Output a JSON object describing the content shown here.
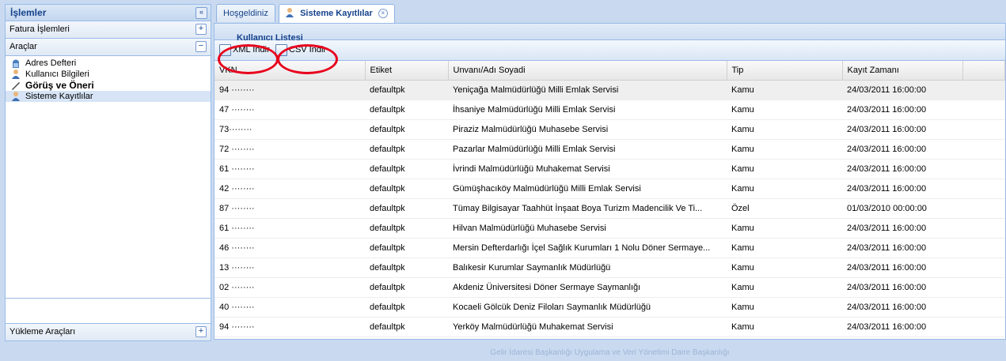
{
  "left_panel": {
    "title": "İşlemler",
    "collapse_glyph": "«",
    "sections": [
      {
        "label": "Fatura İşlemleri",
        "toggle": "+"
      },
      {
        "label": "Araçlar",
        "toggle": "−"
      }
    ],
    "tree_items": [
      {
        "label": "Adres Defteri",
        "icon": "address-book-icon"
      },
      {
        "label": "Kullanıcı Bilgileri",
        "icon": "user-icon"
      },
      {
        "label": "Görüş ve Öneri",
        "icon": "pen-icon"
      },
      {
        "label": "Sisteme Kayıtlılar",
        "icon": "user-icon"
      }
    ],
    "bottom_section": {
      "label": "Yükleme Araçları",
      "toggle": "+"
    }
  },
  "tabs": [
    {
      "label": "Hoşgeldiniz"
    },
    {
      "label": "Sisteme Kayıtlılar",
      "close": "×"
    }
  ],
  "panel_title": "Kullanıcı Listesi",
  "toolbar": {
    "xml_label": "XML İndir",
    "csv_label": "CSV İndir",
    "highlight_color": "#e8001b"
  },
  "grid": {
    "columns": [
      "VKN",
      "Etiket",
      "Unvanı/Adı Soyadi",
      "Tip",
      "Kayıt Zamanı"
    ],
    "rows": [
      [
        "94 ········",
        "defaultpk",
        "Yeniçağa Malmüdürlüğü Milli Emlak Servisi",
        "Kamu",
        "24/03/2011 16:00:00"
      ],
      [
        "47 ········",
        "defaultpk",
        "İhsaniye Malmüdürlüğü Milli Emlak Servisi",
        "Kamu",
        "24/03/2011 16:00:00"
      ],
      [
        "73········",
        "defaultpk",
        "Piraziz Malmüdürlüğü Muhasebe Servisi",
        "Kamu",
        "24/03/2011 16:00:00"
      ],
      [
        "72 ········",
        "defaultpk",
        "Pazarlar Malmüdürlüğü Milli Emlak Servisi",
        "Kamu",
        "24/03/2011 16:00:00"
      ],
      [
        "61 ········",
        "defaultpk",
        "İvrindi Malmüdürlüğü Muhakemat Servisi",
        "Kamu",
        "24/03/2011 16:00:00"
      ],
      [
        "42 ········",
        "defaultpk",
        "Gümüşhacıköy Malmüdürlüğü Milli Emlak Servisi",
        "Kamu",
        "24/03/2011 16:00:00"
      ],
      [
        "87 ········",
        "defaultpk",
        "Tümay Bilgisayar Taahhüt İnşaat Boya Turizm Madencilik Ve Ti...",
        "Özel",
        "01/03/2010 00:00:00"
      ],
      [
        "61 ········",
        "defaultpk",
        "Hilvan Malmüdürlüğü Muhasebe Servisi",
        "Kamu",
        "24/03/2011 16:00:00"
      ],
      [
        "46 ········",
        "defaultpk",
        "Mersin Defterdarlığı İçel Sağlık Kurumları 1 Nolu Döner Sermaye...",
        "Kamu",
        "24/03/2011 16:00:00"
      ],
      [
        "13 ········",
        "defaultpk",
        "Balıkesir Kurumlar Saymanlık Müdürlüğü",
        "Kamu",
        "24/03/2011 16:00:00"
      ],
      [
        "02 ········",
        "defaultpk",
        "Akdeniz Üniversitesi Döner Sermaye Saymanlığı",
        "Kamu",
        "24/03/2011 16:00:00"
      ],
      [
        "40 ········",
        "defaultpk",
        "Kocaeli Gölcük Deniz Filoları Saymanlık Müdürlüğü",
        "Kamu",
        "24/03/2011 16:00:00"
      ],
      [
        "94 ········",
        "defaultpk",
        "Yerköy Malmüdürlüğü Muhakemat Servisi",
        "Kamu",
        "24/03/2011 16:00:00"
      ]
    ]
  },
  "footer": "Gelir İdaresi Başkanlığı Uygulama ve Veri Yönetimi Daire Başkanlığı"
}
